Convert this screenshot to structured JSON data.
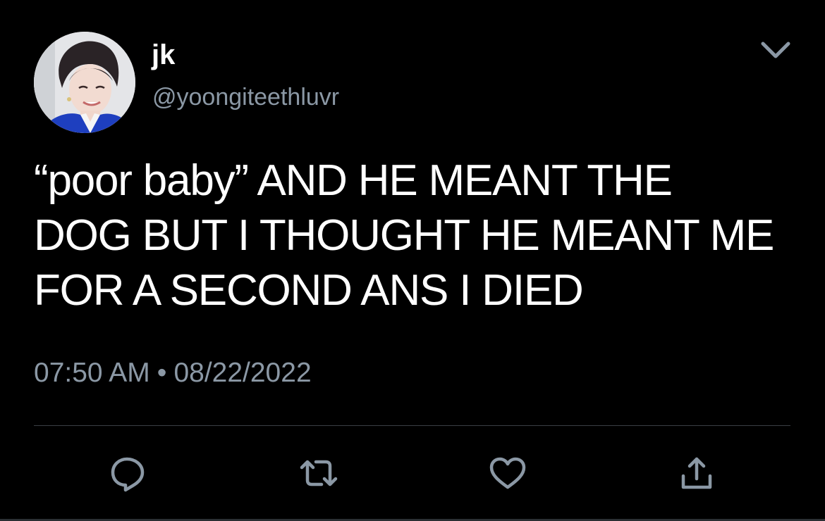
{
  "user": {
    "display_name": "jk",
    "handle": "@yoongiteethluvr"
  },
  "tweet": {
    "text_lines": [
      "“poor baby” AND HE MEANT THE",
      "DOG BUT I THOUGHT HE MEANT ME",
      "FOR A SECOND ANS I DIED"
    ],
    "time": "07:50 AM",
    "separator": "•",
    "date": "08/22/2022"
  },
  "icons": {
    "menu": "chevron-down-icon",
    "reply": "reply-icon",
    "retweet": "retweet-icon",
    "like": "heart-icon",
    "share": "share-icon"
  },
  "colors": {
    "background": "#000000",
    "text": "#ffffff",
    "muted": "#8b98a5",
    "divider": "#3a3f44"
  }
}
